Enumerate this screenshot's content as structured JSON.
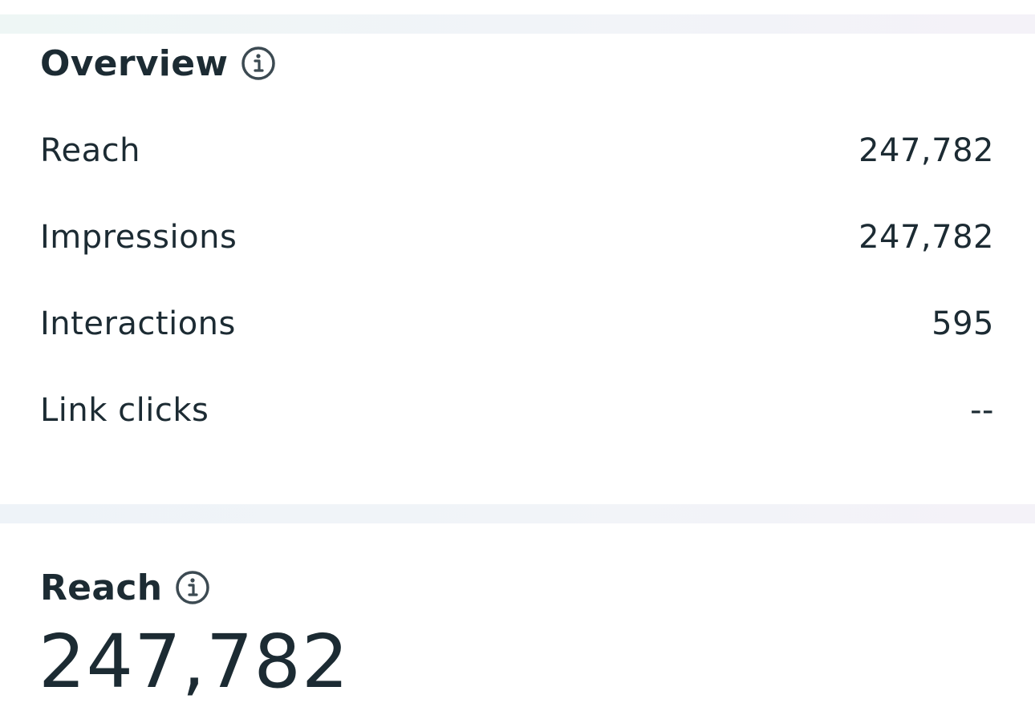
{
  "overview": {
    "title": "Overview",
    "title_icon": "info-icon",
    "metrics": [
      {
        "label": "Reach",
        "value": "247,782"
      },
      {
        "label": "Impressions",
        "value": "247,782"
      },
      {
        "label": "Interactions",
        "value": "595"
      },
      {
        "label": "Link clicks",
        "value": "--"
      }
    ]
  },
  "reach": {
    "title": "Reach",
    "title_icon": "info-icon",
    "value": "247,782"
  },
  "colors": {
    "text": "#1c2b33",
    "divider": "#f1f4f8"
  }
}
